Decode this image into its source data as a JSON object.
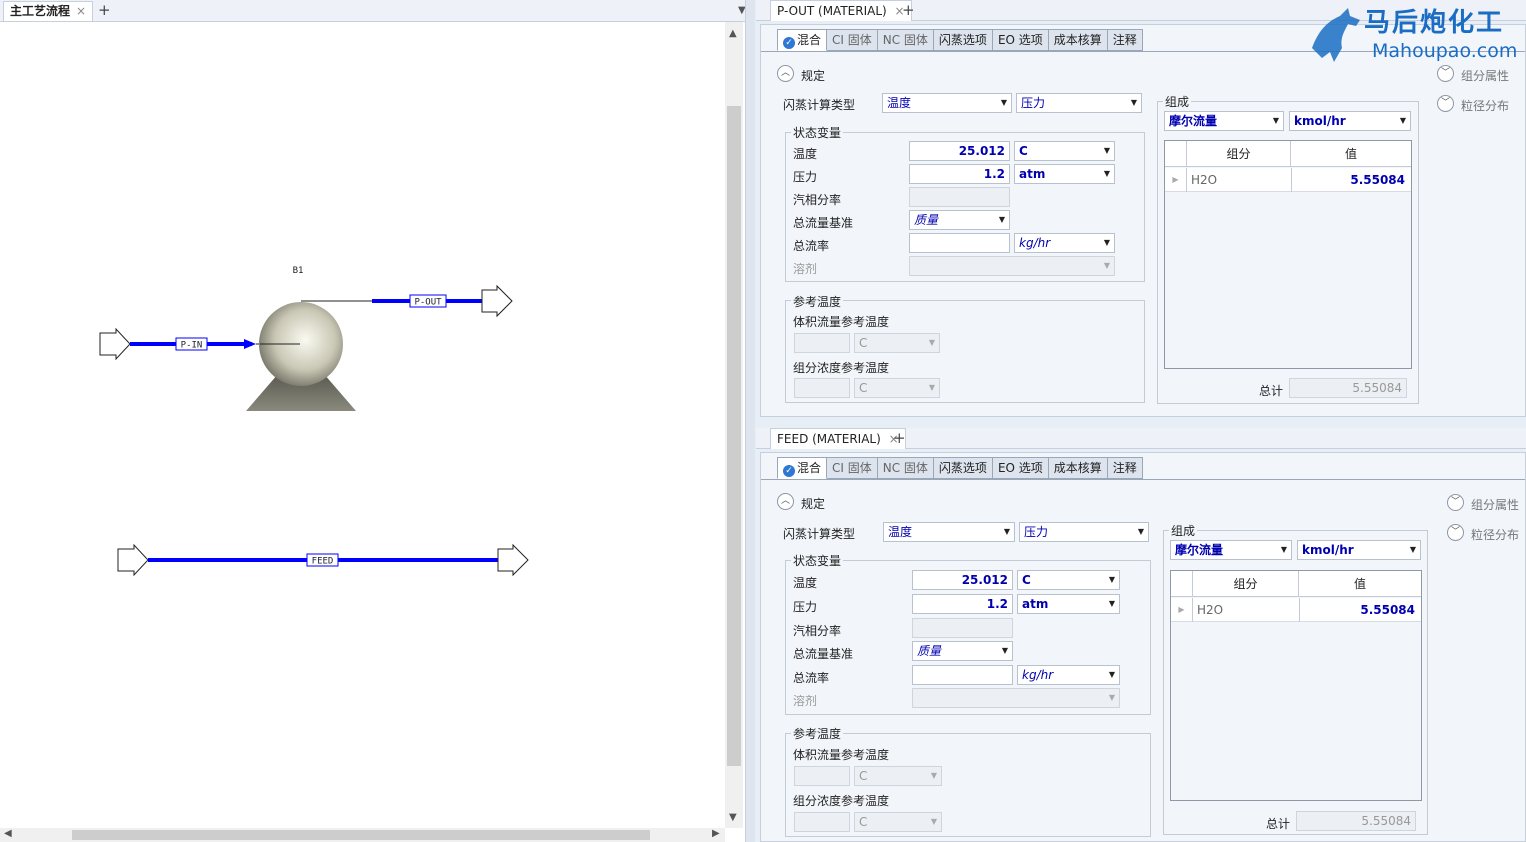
{
  "flowsheet": {
    "tab_label": "主工艺流程",
    "block_label": "B1",
    "streams": {
      "p_in": "P-IN",
      "p_out": "P-OUT",
      "feed": "FEED"
    }
  },
  "panels": [
    {
      "tab_label": "P-OUT (MATERIAL)",
      "tabs": [
        "混合",
        "CI 固体",
        "NC 固体",
        "闪蒸选项",
        "EO 选项",
        "成本核算",
        "注释"
      ],
      "spec_label": "规定",
      "flash_type_label": "闪蒸计算类型",
      "flash_type_1": "温度",
      "flash_type_2": "压力",
      "state_group": "状态变量",
      "temp_label": "温度",
      "temp_value": "25.012",
      "temp_unit": "C",
      "pres_label": "压力",
      "pres_value": "1.2",
      "pres_unit": "atm",
      "vfrac_label": "汽相分率",
      "basis_label": "总流量基准",
      "basis_value": "质量",
      "flow_label": "总流率",
      "flow_unit": "kg/hr",
      "solvent_label": "溶剂",
      "ref_group": "参考温度",
      "vol_ref_label": "体积流量参考温度",
      "vol_ref_unit": "C",
      "conc_ref_label": "组分浓度参考温度",
      "conc_ref_unit": "C",
      "comp_group": "组成",
      "comp_basis": "摩尔流量",
      "comp_unit": "kmol/hr",
      "col_component": "组分",
      "col_value": "值",
      "rows": [
        {
          "name": "H2O",
          "value": "5.55084"
        }
      ],
      "total_label": "总计",
      "total_value": "5.55084",
      "side_links": [
        "组分属性",
        "粒径分布"
      ]
    },
    {
      "tab_label": "FEED (MATERIAL)",
      "tabs": [
        "混合",
        "CI 固体",
        "NC 固体",
        "闪蒸选项",
        "EO 选项",
        "成本核算",
        "注释"
      ],
      "spec_label": "规定",
      "flash_type_label": "闪蒸计算类型",
      "flash_type_1": "温度",
      "flash_type_2": "压力",
      "state_group": "状态变量",
      "temp_label": "温度",
      "temp_value": "25.012",
      "temp_unit": "C",
      "pres_label": "压力",
      "pres_value": "1.2",
      "pres_unit": "atm",
      "vfrac_label": "汽相分率",
      "basis_label": "总流量基准",
      "basis_value": "质量",
      "flow_label": "总流率",
      "flow_unit": "kg/hr",
      "solvent_label": "溶剂",
      "ref_group": "参考温度",
      "vol_ref_label": "体积流量参考温度",
      "vol_ref_unit": "C",
      "conc_ref_label": "组分浓度参考温度",
      "conc_ref_unit": "C",
      "comp_group": "组成",
      "comp_basis": "摩尔流量",
      "comp_unit": "kmol/hr",
      "col_component": "组分",
      "col_value": "值",
      "rows": [
        {
          "name": "H2O",
          "value": "5.55084"
        }
      ],
      "total_label": "总计",
      "total_value": "5.55084",
      "side_links": [
        "组分属性",
        "粒径分布"
      ]
    }
  ],
  "watermark": {
    "line1": "马后炮化工",
    "line2": "Mahoupao.com"
  },
  "colors": {
    "stream": "#0000ff",
    "value_text": "#0000b0",
    "accent": "#2e78d4"
  },
  "icons": [
    "close-icon",
    "plus-icon",
    "check-icon",
    "chevron-up-icon",
    "chevron-down-icon",
    "dropdown-arrow-icon",
    "scroll-up-arrow-icon",
    "scroll-down-arrow-icon",
    "scroll-left-arrow-icon",
    "scroll-right-arrow-icon"
  ]
}
